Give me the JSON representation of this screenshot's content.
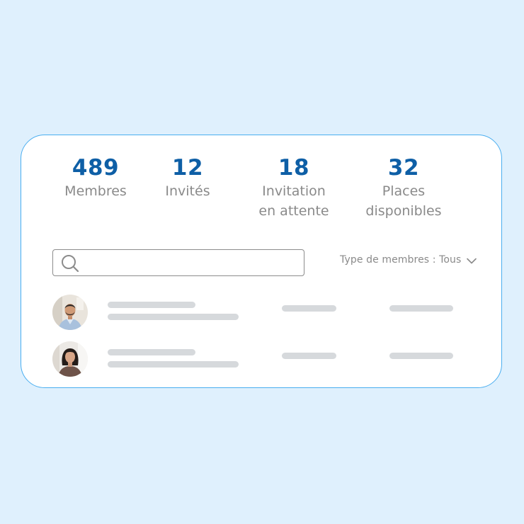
{
  "stats": [
    {
      "value": "489",
      "label": "Membres"
    },
    {
      "value": "12",
      "label": "Invités"
    },
    {
      "value": "18",
      "label": "Invitation\nen attente"
    },
    {
      "value": "32",
      "label": "Places\ndisponibles"
    }
  ],
  "search": {
    "icon": "search-icon",
    "placeholder": "",
    "value": ""
  },
  "filter": {
    "label": "Type de membres : Tous",
    "icon": "chevron-down-icon"
  },
  "members": [
    {
      "avatar": "man-avatar-photo"
    },
    {
      "avatar": "woman-avatar-photo"
    }
  ],
  "colors": {
    "page_background": "#dff0fd",
    "card_border": "#4aaef0",
    "stat_value": "#0e5fa6",
    "stat_label": "#8a8a8a",
    "placeholder_bar": "#d6d9dc"
  }
}
